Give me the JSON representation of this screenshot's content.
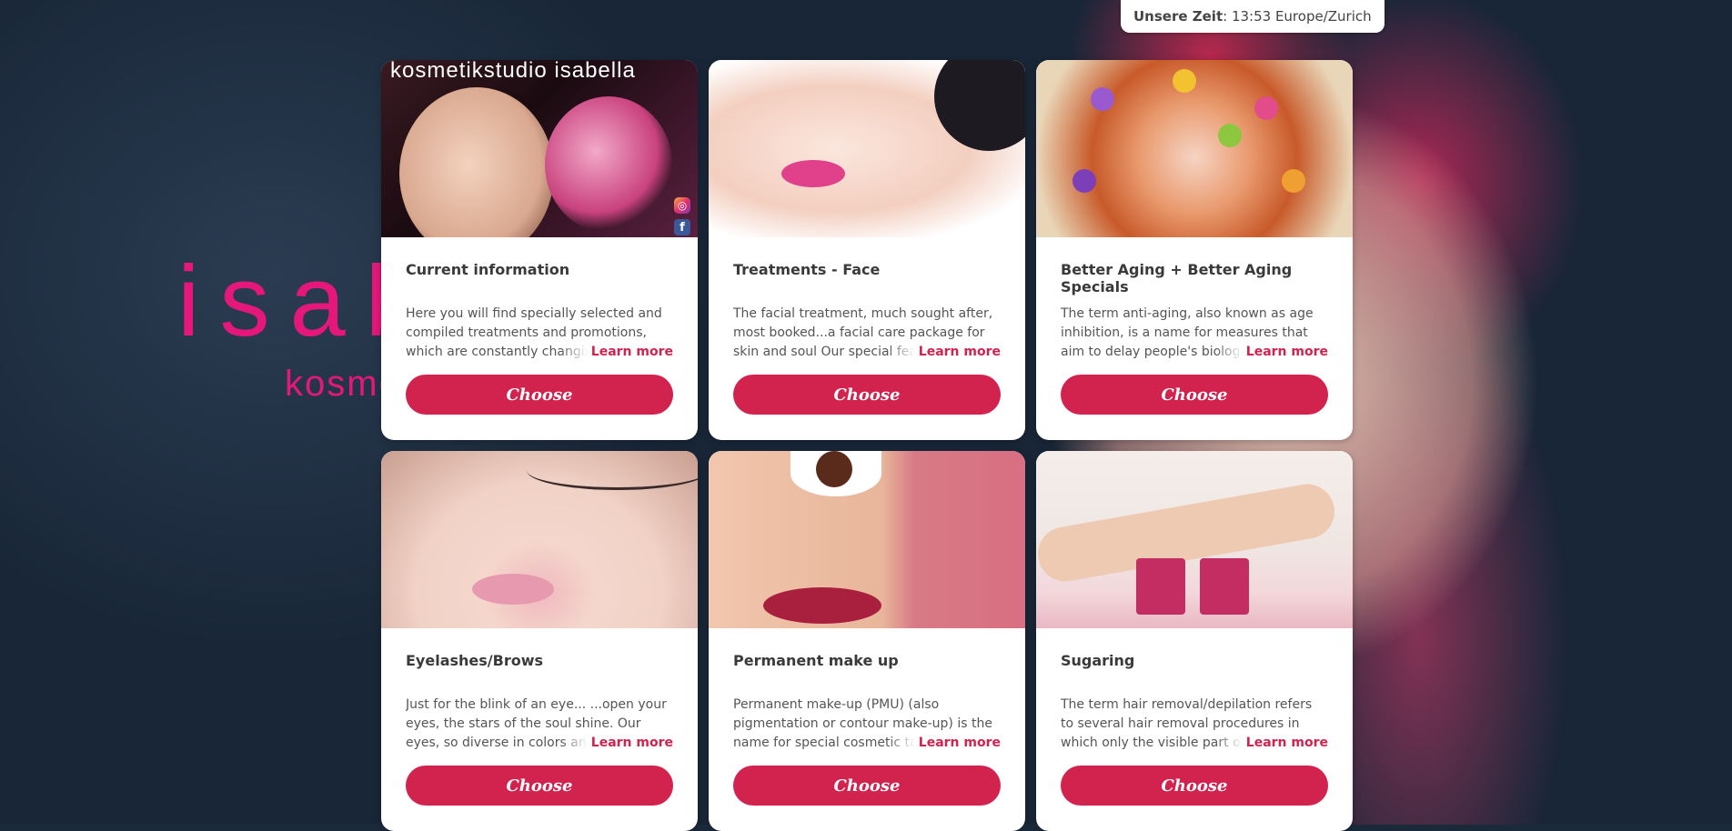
{
  "header": {
    "time_label": "Unsere Zeit",
    "time_value": ": 13:53 Europe/Zurich"
  },
  "background": {
    "logo_main": "isab",
    "logo_sub": "kosme"
  },
  "cards": [
    {
      "image_caption": "kosmetikstudio isabella",
      "title": "Current information",
      "description": "Here you will find specially selected and compiled treatments and promotions, which are constantly changing",
      "learn_more": "Learn more",
      "button": "Choose"
    },
    {
      "title": "Treatments - Face",
      "description": "The facial treatment, much sought after, most booked...a facial care package for skin and soul Our special features",
      "learn_more": "Learn more",
      "button": "Choose"
    },
    {
      "title": "Better Aging + Better Aging Specials",
      "description": "The term anti-aging, also known as age inhibition, is a name for measures that aim to delay people's biological aging",
      "learn_more": "Learn more",
      "button": "Choose"
    },
    {
      "title": "Eyelashes/Brows",
      "description": "Just for the blink of an eye... ...open your eyes, the stars of the soul shine. Our eyes, so diverse in colors and shapes",
      "learn_more": "Learn more",
      "button": "Choose"
    },
    {
      "title": "Permanent make up",
      "description": "Permanent make-up (PMU) (also pigmentation or contour make-up) is the name for special cosmetic tattoos",
      "learn_more": "Learn more",
      "button": "Choose"
    },
    {
      "title": "Sugaring",
      "description": "The term hair removal/depilation refers to several hair removal procedures in which only the visible part of the hair",
      "learn_more": "Learn more",
      "button": "Choose"
    }
  ],
  "colors": {
    "accent": "#d2234f",
    "logo": "#e5177a"
  },
  "icons": {
    "instagram": "instagram-icon",
    "facebook": "facebook-icon"
  }
}
